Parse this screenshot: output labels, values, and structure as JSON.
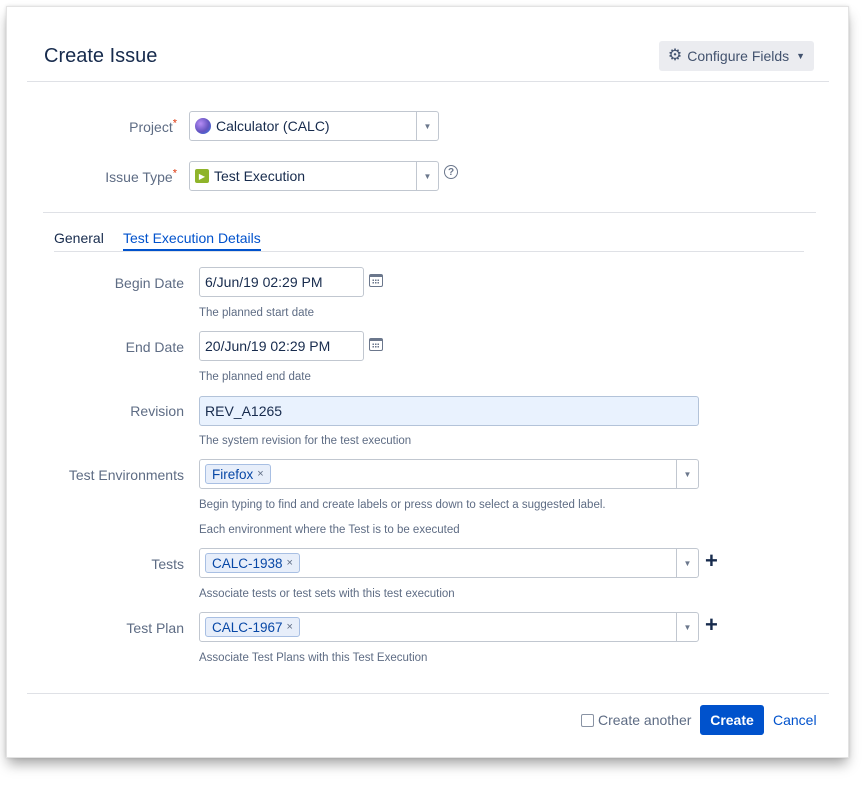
{
  "dialog": {
    "title": "Create Issue",
    "configure_label": "Configure Fields"
  },
  "project": {
    "label": "Project",
    "required_mark": "*",
    "value": "Calculator (CALC)"
  },
  "issue_type": {
    "label": "Issue Type",
    "required_mark": "*",
    "value": "Test Execution",
    "help_glyph": "?"
  },
  "tabs": [
    {
      "label": "General",
      "active": false
    },
    {
      "label": "Test Execution Details",
      "active": true
    }
  ],
  "begin_date": {
    "label": "Begin Date",
    "value": "6/Jun/19 02:29 PM",
    "description": "The planned start date"
  },
  "end_date": {
    "label": "End Date",
    "value": "20/Jun/19 02:29 PM",
    "description": "The planned end date"
  },
  "revision": {
    "label": "Revision",
    "value": "REV_A1265",
    "description": "The system revision for the test execution"
  },
  "test_environments": {
    "label": "Test Environments",
    "tags": [
      "Firefox"
    ],
    "hint": "Begin typing to find and create labels or press down to select a suggested label.",
    "description": "Each environment where the Test is to be executed"
  },
  "tests": {
    "label": "Tests",
    "tags": [
      "CALC-1938"
    ],
    "description": "Associate tests or test sets with this test execution"
  },
  "test_plan": {
    "label": "Test Plan",
    "tags": [
      "CALC-1967"
    ],
    "description": "Associate Test Plans with this Test Execution"
  },
  "footer": {
    "create_another_label": "Create another",
    "create_label": "Create",
    "cancel_label": "Cancel"
  },
  "icons": {
    "gear": "gear-icon",
    "calendar": "calendar-icon",
    "remove": "×",
    "add": "+"
  },
  "colors": {
    "primary": "#0052cc",
    "required": "#de350b",
    "issue_type_icon": "#8fb42a"
  }
}
